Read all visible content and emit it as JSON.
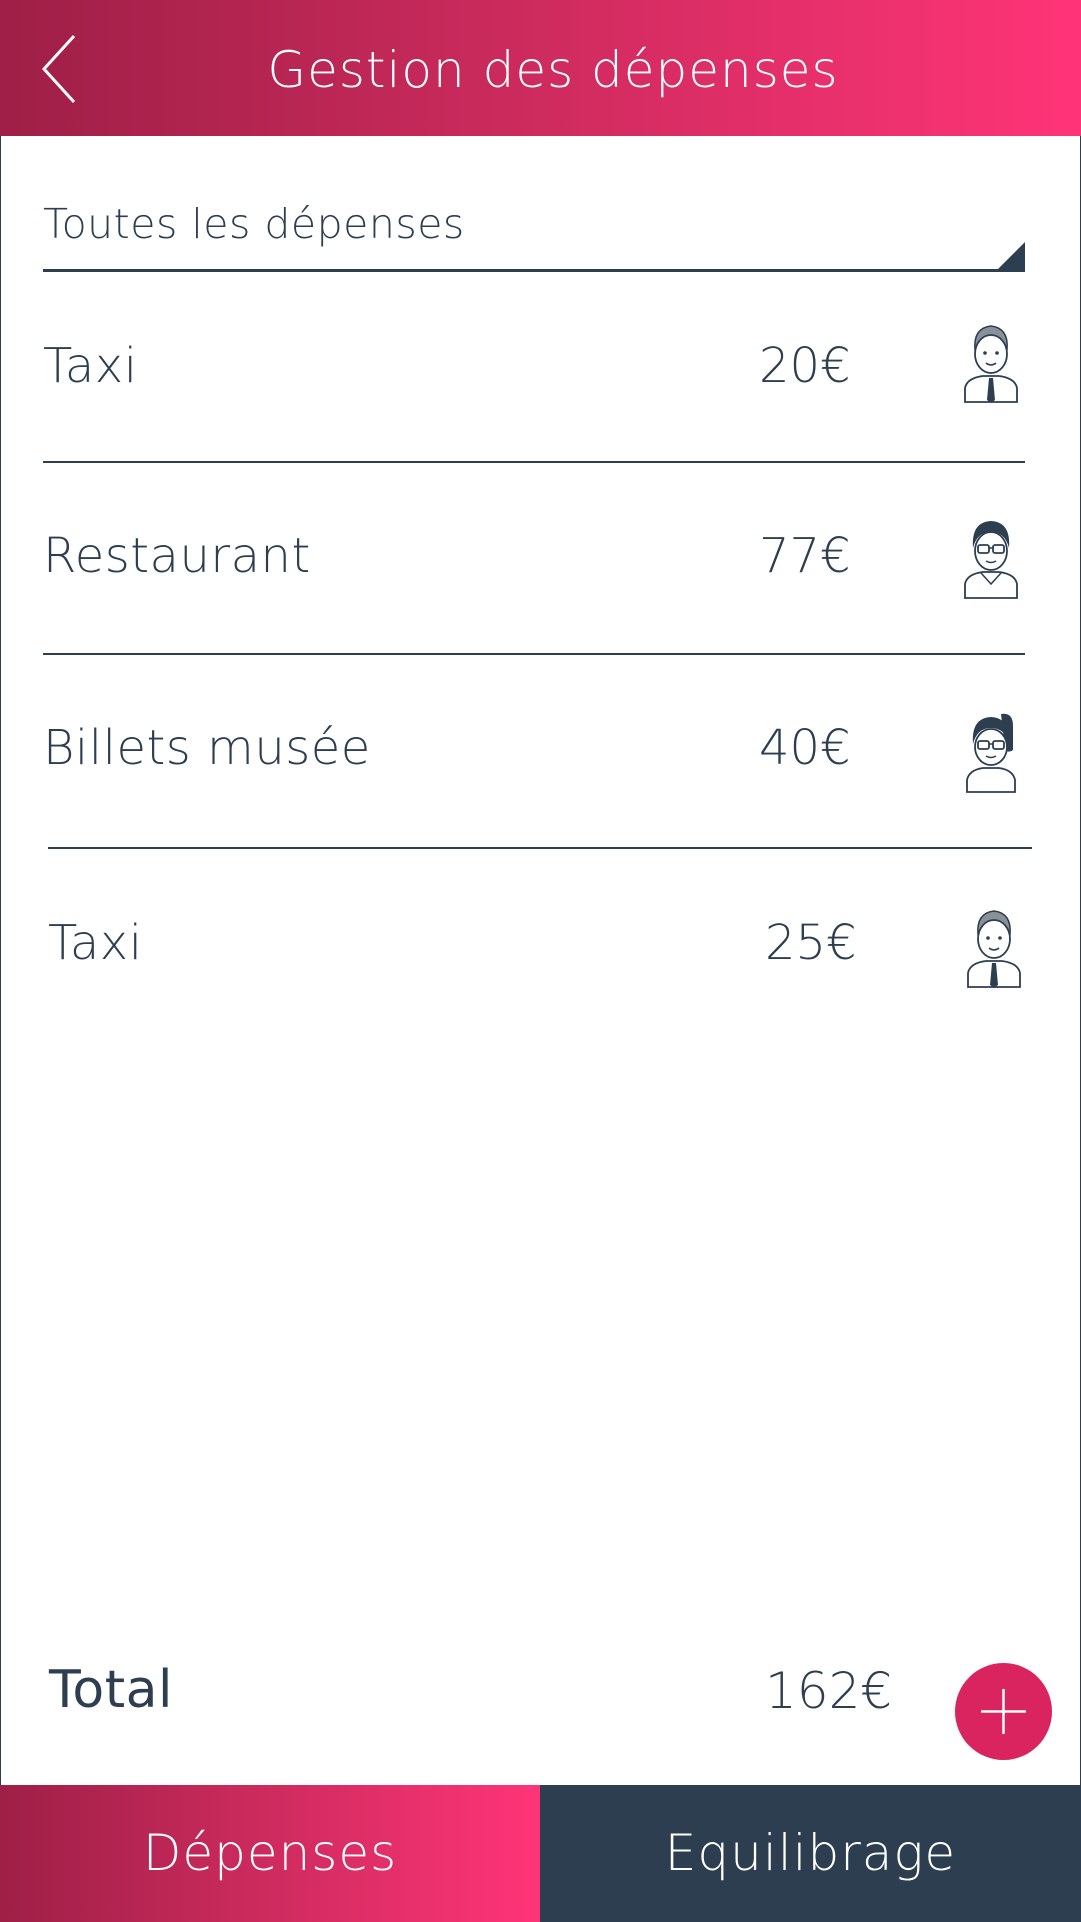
{
  "header": {
    "title": "Gestion des dépenses",
    "back_icon": "chevron-left-icon"
  },
  "filter": {
    "selected": "Toutes les dépenses"
  },
  "expenses": [
    {
      "label": "Taxi",
      "amount": "20€",
      "avatar": "man-with-tie-avatar"
    },
    {
      "label": "Restaurant",
      "amount": "77€",
      "avatar": "man-with-glasses-avatar"
    },
    {
      "label": "Billets musée",
      "amount": "40€",
      "avatar": "woman-with-glasses-avatar"
    },
    {
      "label": "Taxi",
      "amount": "25€",
      "avatar": "man-with-tie-avatar"
    }
  ],
  "total": {
    "label": "Total",
    "amount": "162€"
  },
  "fab": {
    "icon": "plus-icon"
  },
  "tabs": [
    {
      "label": "Dépenses",
      "active": true
    },
    {
      "label": "Equilibrage",
      "active": false
    }
  ],
  "colors": {
    "accent": "#ff3478",
    "accent_dark": "#9e1f47",
    "fab": "#d9245f",
    "navy": "#2c3e50",
    "background": "#ffffff"
  }
}
